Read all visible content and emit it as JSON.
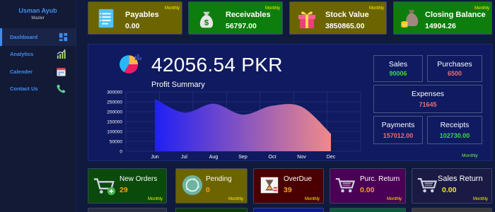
{
  "user": {
    "name": "Usman Ayub",
    "role": "Master"
  },
  "nav": [
    {
      "label": "Dashboard",
      "icon": "dashboard-icon"
    },
    {
      "label": "Analytics",
      "icon": "bar-chart-icon"
    },
    {
      "label": "Calender",
      "icon": "calendar-icon"
    },
    {
      "label": "Contact Us",
      "icon": "phone-icon"
    }
  ],
  "top_cards": [
    {
      "title": "Payables",
      "value": "0.00",
      "period": "Monthly",
      "icon": "document-list-icon",
      "color": "#6b6400"
    },
    {
      "title": "Receivables",
      "value": "56797.00",
      "period": "Monthly",
      "icon": "money-bag-icon",
      "color": "#0d7e0d"
    },
    {
      "title": "Stock Value",
      "value": "3850865.00",
      "period": "Monthly",
      "icon": "gift-box-icon",
      "color": "#6b6400"
    },
    {
      "title": "Closing Balance",
      "value": "14904.26",
      "period": "Monthly",
      "icon": "coin-bag-icon",
      "color": "#0d7e0d"
    }
  ],
  "summary": {
    "total": "42056.54 PKR",
    "chart_title": "Profit Summary",
    "period": "Monthly"
  },
  "stats": {
    "sales": {
      "label": "Sales",
      "value": "90006",
      "color": "#3cdc3c"
    },
    "purchases": {
      "label": "Purchases",
      "value": "6500",
      "color": "#f06e6e"
    },
    "expenses": {
      "label": "Expenses",
      "value": "71645",
      "color": "#f06e6e"
    },
    "payments": {
      "label": "Payments",
      "value": "157012.00",
      "color": "#f06e6e"
    },
    "receipts": {
      "label": "Receipts",
      "value": "102730.00",
      "color": "#3cdc3c"
    }
  },
  "chart_data": {
    "type": "area",
    "categories": [
      "Jun",
      "Jul",
      "Aug",
      "Sep",
      "Oct",
      "Nov",
      "Dec"
    ],
    "values": [
      265000,
      195000,
      240000,
      185000,
      230000,
      225000,
      88000
    ],
    "ylim": [
      0,
      300000
    ],
    "yticks": [
      "0",
      "50000",
      "100000",
      "150000",
      "200000",
      "250000",
      "300000"
    ],
    "title": "",
    "gradient": [
      "#1f1ff5",
      "#f08a8a"
    ]
  },
  "bottom_cards": [
    {
      "title": "New Orders",
      "value": "29",
      "period": "Monthly",
      "icon": "cart-plus-icon",
      "color": "#0a4a0a",
      "value_color": "#f5a31a"
    },
    {
      "title": "Pending",
      "value": "0",
      "period": "Monthly",
      "icon": "recycle-icon",
      "color": "#6b6400",
      "value_color": "#f5a31a"
    },
    {
      "title": "OverDue",
      "value": "39",
      "period": "Monthly",
      "icon": "hourglass-icon",
      "color": "#4a0000",
      "value_color": "#f5a31a"
    },
    {
      "title": "Purc. Return",
      "value": "0.00",
      "period": "Monthly",
      "icon": "cart-return-icon",
      "color": "#4a0055",
      "value_color": "#f5a31a"
    },
    {
      "title": "Sales Return",
      "value": "0.00",
      "period": "Monthly",
      "icon": "cart-return-icon",
      "color": "#1a1a44",
      "value_color": "#f5e81a"
    }
  ]
}
